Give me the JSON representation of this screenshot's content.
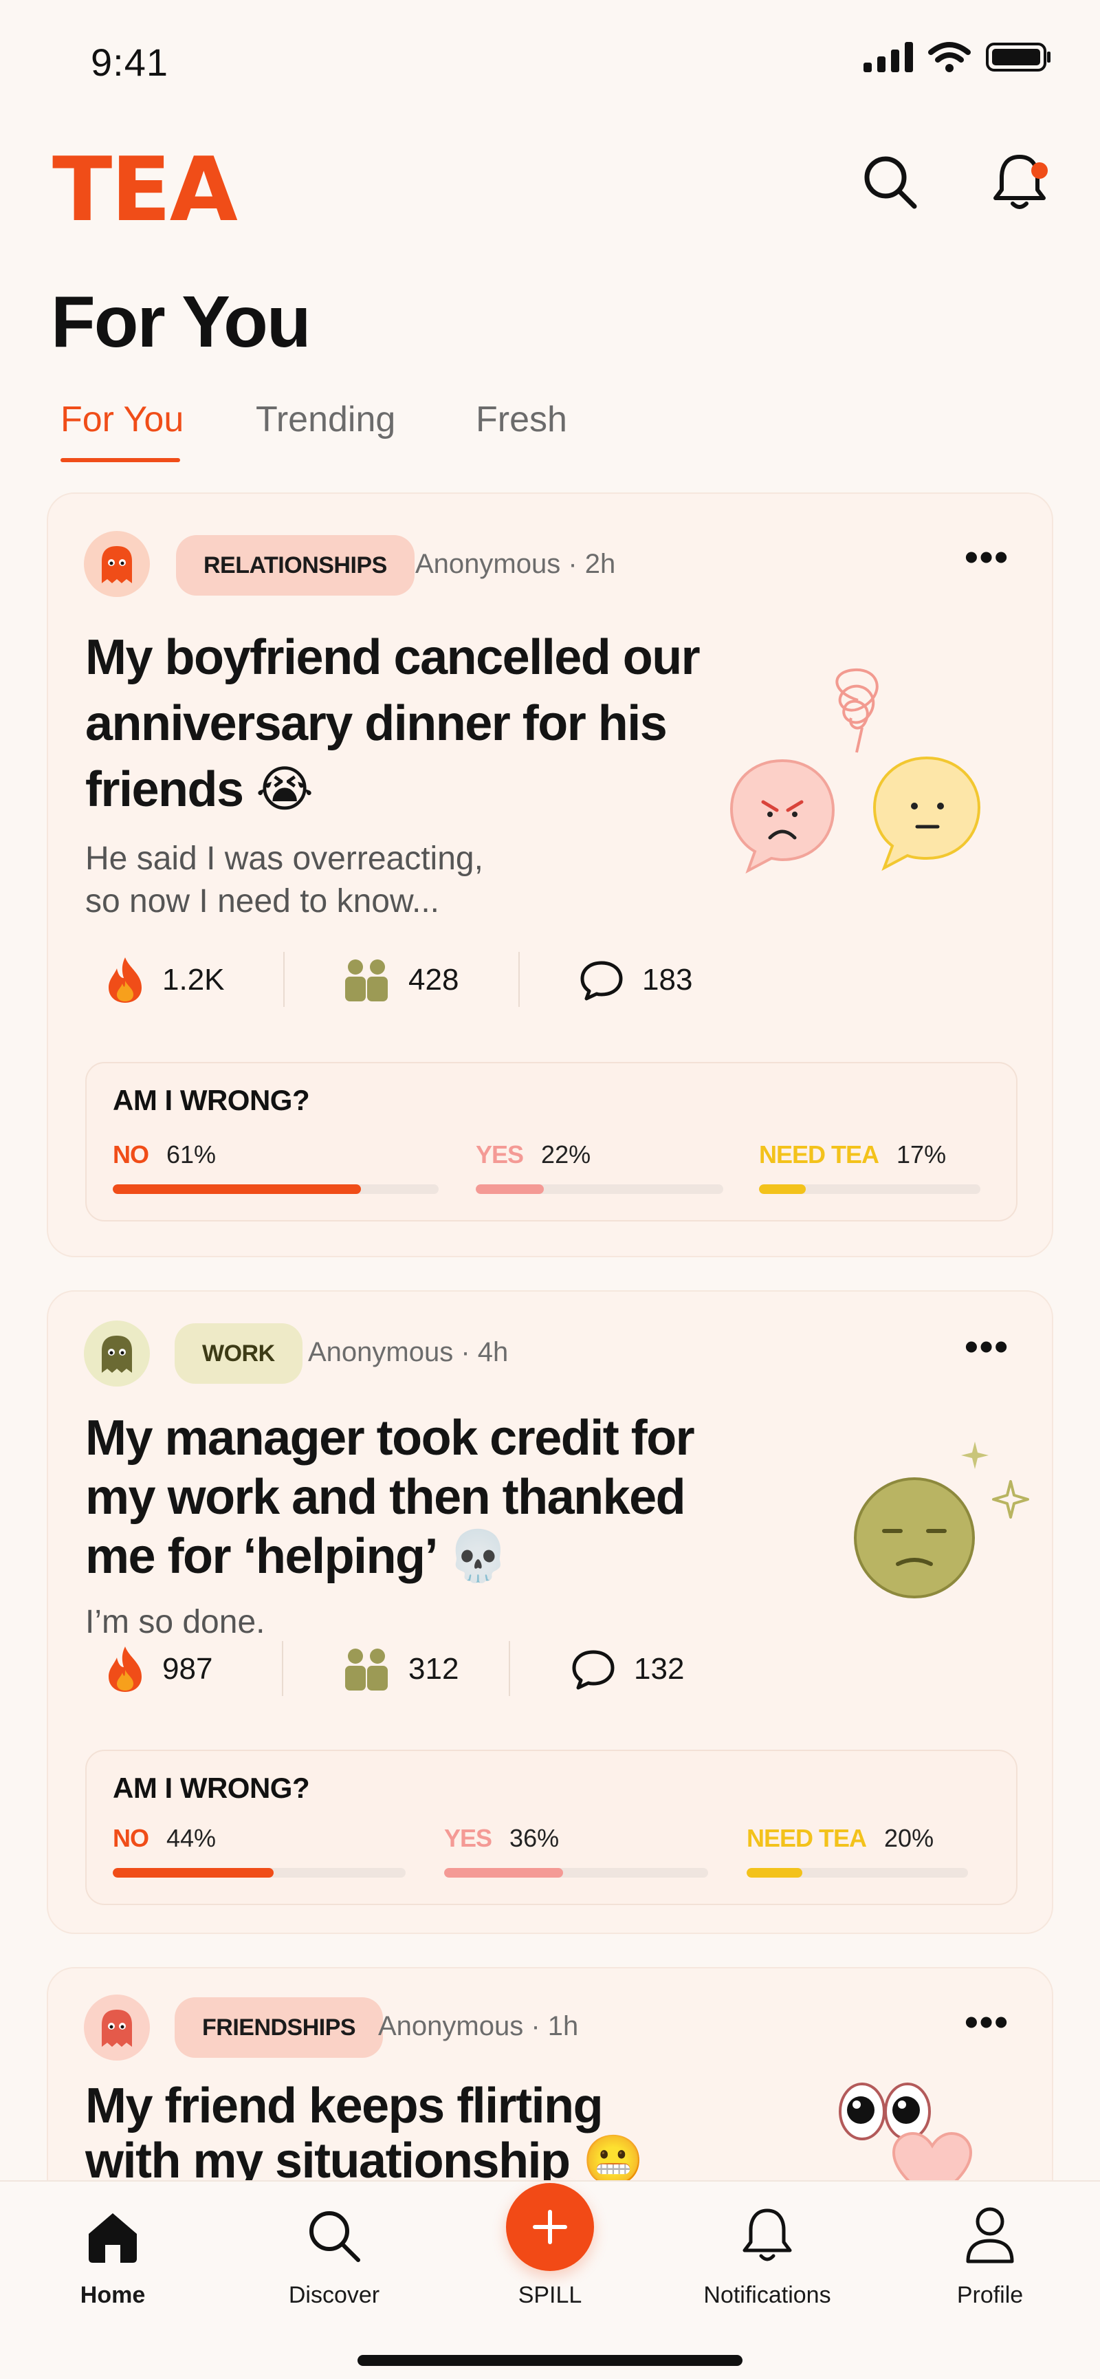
{
  "status": {
    "time": "9:41"
  },
  "header": {
    "logo": "TEA",
    "search_icon": "search-icon",
    "bell_icon": "bell-icon",
    "bell_dot_color": "#f04d18"
  },
  "page": {
    "title": "For You"
  },
  "tabs": [
    {
      "label": "For You",
      "active": true
    },
    {
      "label": "Trending",
      "active": false
    },
    {
      "label": "Fresh",
      "active": false
    }
  ],
  "posts": [
    {
      "tag": "RELATIONSHIPS",
      "meta": "Anonymous · 2h",
      "title_lines": [
        "My boyfriend cancelled our",
        "anniversary dinner for his",
        "friends 😭"
      ],
      "body_lines": [
        "He said I was overreacting,",
        "so now I need to know..."
      ],
      "stats": {
        "fire": "1.2K",
        "people": "428",
        "comments": "183"
      },
      "poll": {
        "question": "AM I WRONG?",
        "options": [
          {
            "label": "NO",
            "percent": "61%",
            "value": 0.61,
            "color": "#f04d18"
          },
          {
            "label": "YES",
            "percent": "22%",
            "value": 0.22,
            "color": "#f49a95"
          },
          {
            "label": "NEED TEA",
            "percent": "17%",
            "value": 0.17,
            "color": "#f3c21b"
          }
        ]
      }
    },
    {
      "tag": "WORK",
      "meta": "Anonymous · 4h",
      "title_lines": [
        "My manager took credit for",
        "my work and then thanked",
        "me for ‘helping’ 💀"
      ],
      "body_lines": [
        "I’m so done."
      ],
      "stats": {
        "fire": "987",
        "people": "312",
        "comments": "132"
      },
      "poll": {
        "question": "AM I WRONG?",
        "options": [
          {
            "label": "NO",
            "percent": "44%",
            "value": 0.44,
            "color": "#f04d18"
          },
          {
            "label": "YES",
            "percent": "36%",
            "value": 0.36,
            "color": "#f49a95"
          },
          {
            "label": "NEED TEA",
            "percent": "20%",
            "value": 0.2,
            "color": "#f3c21b"
          }
        ]
      }
    },
    {
      "tag": "FRIENDSHIPS",
      "meta": "Anonymous · 1h",
      "title_lines": [
        "My friend keeps flirting",
        "with my situationship 😬"
      ]
    }
  ],
  "nav": {
    "home": "Home",
    "discover": "Discover",
    "spill": "SPILL",
    "notifications": "Notifications",
    "profile": "Profile"
  },
  "colors": {
    "accent": "#f04d18",
    "background": "#fcf7f3",
    "card": "#fdf3ed"
  }
}
